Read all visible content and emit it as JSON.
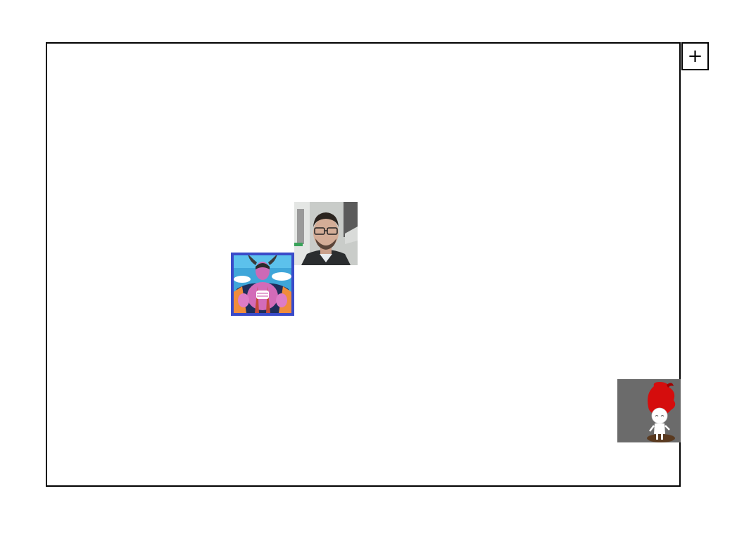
{
  "toolbar": {
    "add_label": "+"
  },
  "tiles": [
    {
      "name": "man-with-glasses-photo",
      "selected": false
    },
    {
      "name": "horned-purple-character-image",
      "selected": true
    },
    {
      "name": "red-flame-hair-chibi-image",
      "selected": false
    }
  ],
  "colors": {
    "selection_border": "#3a4bc9",
    "canvas_border": "#000000",
    "background": "#ffffff"
  }
}
